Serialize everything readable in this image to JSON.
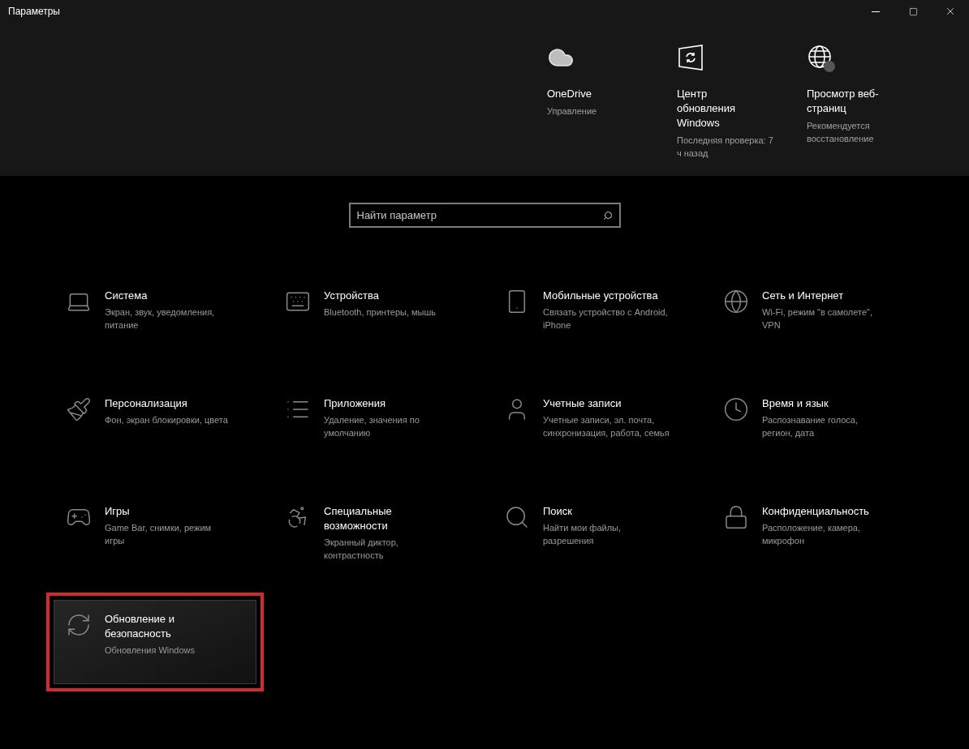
{
  "window": {
    "title": "Параметры"
  },
  "header_items": [
    {
      "title": "OneDrive",
      "subtitle": "Управление"
    },
    {
      "title": "Центр обновления Windows",
      "subtitle": "Последняя проверка: 7 ч назад"
    },
    {
      "title": "Просмотр веб-страниц",
      "subtitle": "Рекомендуется восстановление"
    }
  ],
  "search": {
    "placeholder": "Найти параметр"
  },
  "categories": [
    {
      "title": "Система",
      "subtitle": "Экран, звук, уведомления, питание",
      "selected": false,
      "highlighted": false
    },
    {
      "title": "Устройства",
      "subtitle": "Bluetooth, принтеры, мышь",
      "selected": false,
      "highlighted": false
    },
    {
      "title": "Мобильные устройства",
      "subtitle": "Связать устройство с Android, iPhone",
      "selected": false,
      "highlighted": false
    },
    {
      "title": "Сеть и Интернет",
      "subtitle": "Wi-Fi, режим \"в самолете\", VPN",
      "selected": false,
      "highlighted": false
    },
    {
      "title": "Персонализация",
      "subtitle": "Фон, экран блокировки, цвета",
      "selected": false,
      "highlighted": false
    },
    {
      "title": "Приложения",
      "subtitle": "Удаление, значения по умолчанию",
      "selected": false,
      "highlighted": false
    },
    {
      "title": "Учетные записи",
      "subtitle": "Учетные записи, эл. почта, синхронизация, работа, семья",
      "selected": false,
      "highlighted": false
    },
    {
      "title": "Время и язык",
      "subtitle": "Распознавание голоса, регион, дата",
      "selected": false,
      "highlighted": false
    },
    {
      "title": "Игры",
      "subtitle": "Game Bar, снимки, режим игры",
      "selected": false,
      "highlighted": false
    },
    {
      "title": "Специальные возможности",
      "subtitle": "Экранный диктор, контрастность",
      "selected": false,
      "highlighted": false
    },
    {
      "title": "Поиск",
      "subtitle": "Найти мои файлы, разрешения",
      "selected": false,
      "highlighted": false
    },
    {
      "title": "Конфиденциальность",
      "subtitle": "Расположение, камера, микрофон",
      "selected": false,
      "highlighted": false
    },
    {
      "title": "Обновление и безопасность",
      "subtitle": "Обновления Windows",
      "selected": true,
      "highlighted": true
    }
  ]
}
